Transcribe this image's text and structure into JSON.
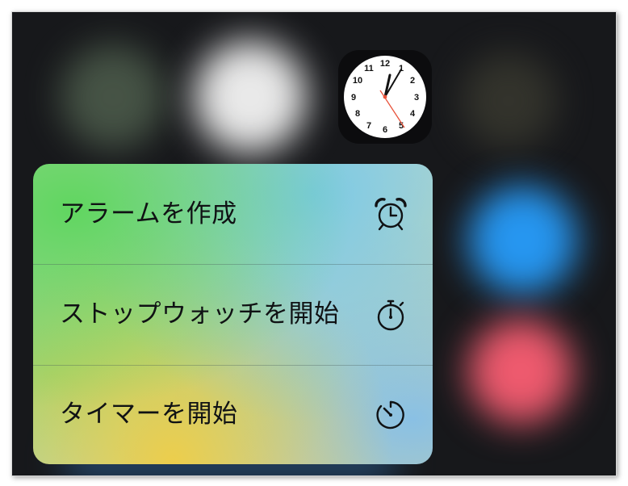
{
  "app": {
    "name": "clock-app",
    "icon": "clock-face-icon",
    "clock_numbers": [
      "12",
      "1",
      "2",
      "3",
      "4",
      "5",
      "6",
      "7",
      "8",
      "9",
      "10",
      "11"
    ]
  },
  "quick_actions": [
    {
      "label": "アラームを作成",
      "icon": "alarm-clock-icon"
    },
    {
      "label": "ストップウォッチを開始",
      "icon": "stopwatch-icon"
    },
    {
      "label": "タイマーを開始",
      "icon": "timer-icon"
    }
  ],
  "colors": {
    "second_hand": "#e8523a",
    "text": "#101214"
  }
}
